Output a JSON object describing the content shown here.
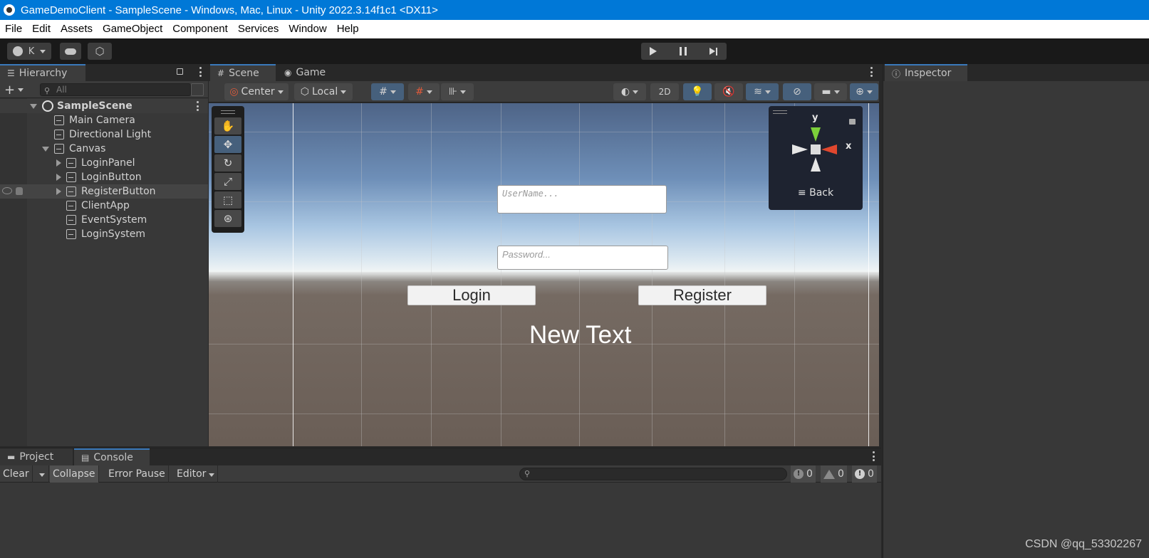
{
  "window": {
    "title": "GameDemoClient - SampleScene - Windows, Mac, Linux - Unity 2022.3.14f1c1 <DX11>"
  },
  "menu": [
    "File",
    "Edit",
    "Assets",
    "GameObject",
    "Component",
    "Services",
    "Window",
    "Help"
  ],
  "toolbar": {
    "account_label": "K"
  },
  "hierarchy": {
    "tab_label": "Hierarchy",
    "search_placeholder": "All",
    "scene": "SampleScene",
    "items": [
      {
        "label": "Main Camera"
      },
      {
        "label": "Directional Light"
      },
      {
        "label": "Canvas"
      },
      {
        "label": "LoginPanel"
      },
      {
        "label": "LoginButton"
      },
      {
        "label": "RegisterButton"
      },
      {
        "label": "ClientApp"
      },
      {
        "label": "EventSystem"
      },
      {
        "label": "LoginSystem"
      }
    ]
  },
  "scene_view": {
    "tabs": [
      "Scene",
      "Game"
    ],
    "pivot_label": "Center",
    "space_label": "Local",
    "mode_2d_label": "2D",
    "username_placeholder": "UserName...",
    "password_placeholder": "Password...",
    "login_label": "Login",
    "register_label": "Register",
    "new_text": "New Text",
    "gizmo": {
      "y_label": "y",
      "x_label": "x",
      "back_label": "Back"
    }
  },
  "inspector": {
    "tab_label": "Inspector"
  },
  "console": {
    "tabs": [
      "Project",
      "Console"
    ],
    "clear_label": "Clear",
    "collapse_label": "Collapse",
    "error_pause_label": "Error Pause",
    "editor_label": "Editor",
    "info_count": "0",
    "warning_count": "0",
    "error_count": "0"
  },
  "watermark": "CSDN @qq_53302267",
  "colors": {
    "titlebar": "#0078d7",
    "accent": "#3a79bb",
    "panel": "#383838"
  }
}
